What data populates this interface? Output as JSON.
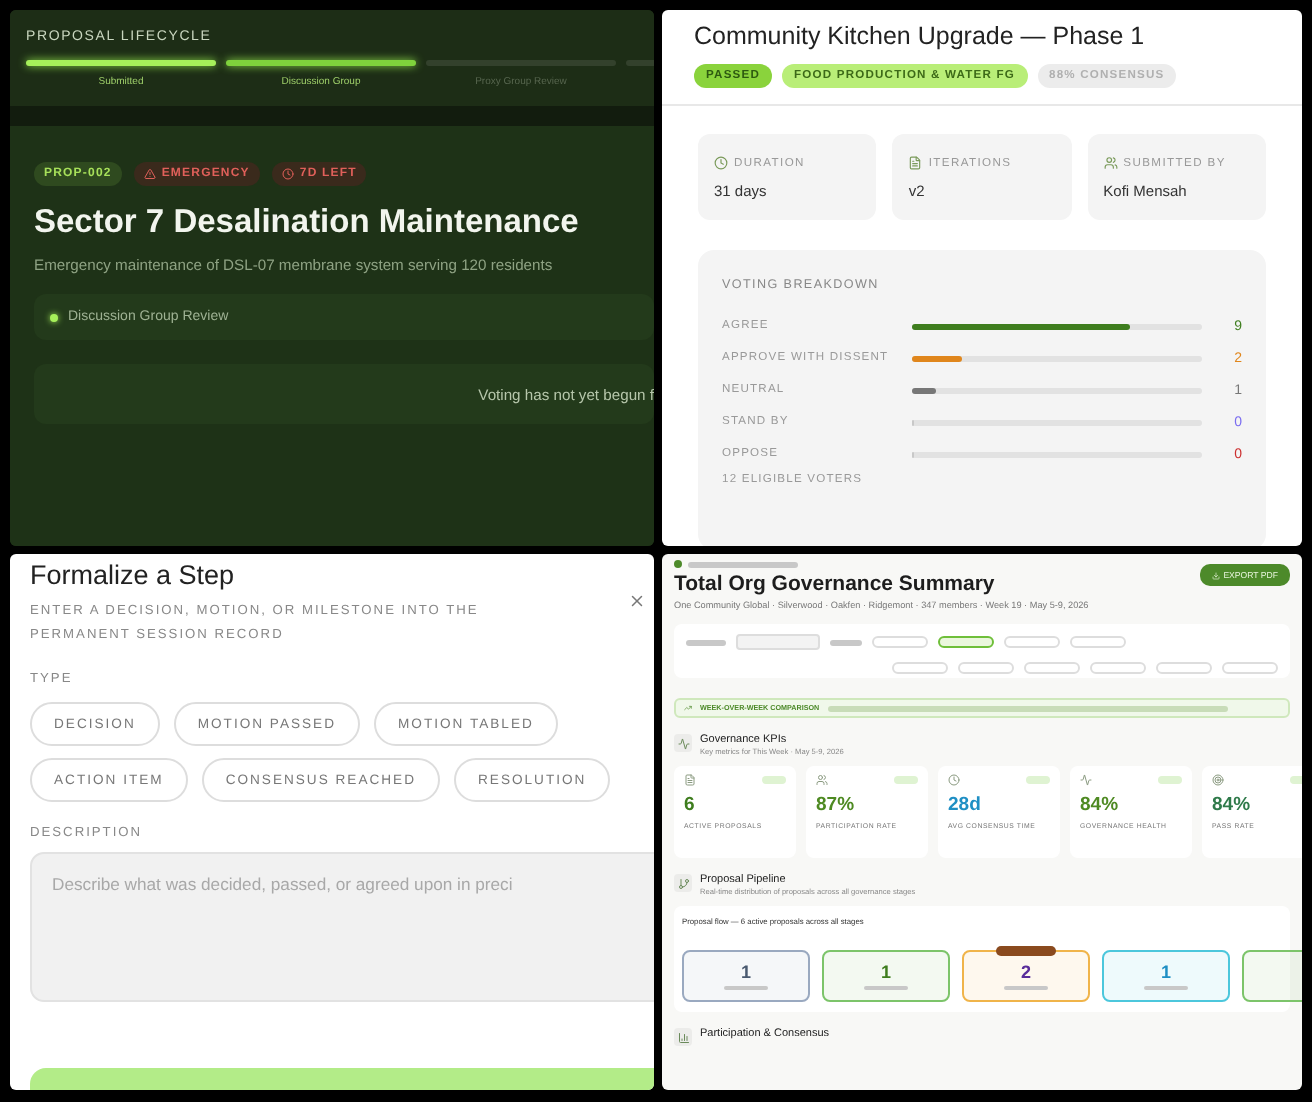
{
  "lifecycle": {
    "heading": "PROPOSAL LIFECYCLE",
    "stages": [
      {
        "label": "Submitted",
        "kind": "done"
      },
      {
        "label": "Discussion Group",
        "kind": "current"
      },
      {
        "label": "Proxy Group Review",
        "kind": "pending"
      },
      {
        "kind": "pending"
      }
    ],
    "tags": [
      {
        "label": "PROP-002",
        "kind": "id"
      },
      {
        "label": "EMERGENCY",
        "kind": "emergency"
      },
      {
        "label": "7D LEFT",
        "kind": "deadline"
      }
    ],
    "title": "Sector 7 Desalination Maintenance",
    "description": "Emergency maintenance of DSL-07 membrane system serving 120 residents",
    "status": "Discussion Group Review",
    "voting_note": "Voting has not yet begun f"
  },
  "proposal": {
    "title": "Community Kitchen Upgrade — Phase 1",
    "badges": [
      {
        "label": "PASSED",
        "kind": "strong"
      },
      {
        "label": "FOOD PRODUCTION & WATER FG",
        "kind": "soft"
      },
      {
        "label": "88% CONSENSUS",
        "kind": "muted"
      }
    ],
    "stats": [
      {
        "label": "DURATION",
        "value": "31 days",
        "kind": "clock"
      },
      {
        "label": "ITERATIONS",
        "value": "v2",
        "kind": "file"
      },
      {
        "label": "SUBMITTED BY",
        "value": "Kofi Mensah",
        "kind": "people"
      }
    ],
    "voting": {
      "title": "VOTING BREAKDOWN",
      "rows": [
        {
          "label": "AGREE",
          "count": "9",
          "level": 0.75,
          "color": "#3e7d1e"
        },
        {
          "label": "APPROVE WITH DISSENT",
          "count": "2",
          "level": 0.17,
          "color": "#e0861c"
        },
        {
          "label": "NEUTRAL",
          "count": "1",
          "level": 0.08,
          "color": "#777777"
        },
        {
          "label": "STAND BY",
          "count": "0",
          "level": 0,
          "color": "#7a6cf0"
        },
        {
          "label": "OPPOSE",
          "count": "0",
          "level": 0,
          "color": "#cc2f2f"
        }
      ],
      "footer": "12 ELIGIBLE VOTERS"
    }
  },
  "formalize": {
    "title": "Formalize a Step",
    "subtitle": "ENTER A DECISION, MOTION, OR MILESTONE INTO THE PERMANENT SESSION RECORD",
    "type_label": "TYPE",
    "types": [
      {
        "label": "DECISION",
        "selected": false
      },
      {
        "label": "MOTION PASSED",
        "selected": false
      },
      {
        "label": "MOTION TABLED",
        "selected": false
      },
      {
        "label": "ACTION ITEM",
        "selected": false
      },
      {
        "label": "CONSENSUS REACHED",
        "selected": false
      },
      {
        "label": "RESOLUTION",
        "selected": false
      }
    ],
    "description_label": "DESCRIPTION",
    "description": {
      "placeholder": "Describe what was decided, passed, or agreed upon in preci"
    }
  },
  "report": {
    "title": "Total Org Governance Summary",
    "subtitle": "One Community Global · Silverwood · Oakfen · Ridgemont · 347 members · Week 19 · May 5-9, 2026",
    "export_button": "EXPORT PDF",
    "comparison": "WEEK-OVER-WEEK COMPARISON",
    "kpis": {
      "title": "Governance KPIs",
      "subtitle": "Key metrics for This Week · May 5-9, 2026",
      "cards": [
        {
          "value": "6",
          "label": "ACTIVE PROPOSALS",
          "color": "#3e7d1e"
        },
        {
          "value": "87%",
          "label": "PARTICIPATION RATE",
          "color": "#4e8a22"
        },
        {
          "value": "28d",
          "label": "AVG CONSENSUS TIME",
          "color": "#1f8fc4"
        },
        {
          "value": "84%",
          "label": "GOVERNANCE HEALTH",
          "color": "#4e8a22"
        },
        {
          "value": "84%",
          "label": "PASS RATE",
          "color": "#2f7a4a"
        }
      ]
    },
    "pipeline": {
      "title": "Proposal Pipeline",
      "subtitle": "Real-time distribution of proposals across all governance stages",
      "flow_title": "Proposal flow — 6 active proposals across all stages",
      "stages": [
        {
          "count": "1",
          "color": "#9aa9c0",
          "flagged": false
        },
        {
          "count": "1",
          "color": "#7cc46a",
          "flagged": false
        },
        {
          "count": "2",
          "color": "#f0b44a",
          "flagged": true
        },
        {
          "count": "1",
          "color": "#4cc7dc",
          "flagged": false
        },
        {
          "color": "#7cc46a",
          "flagged": false
        }
      ]
    },
    "next_section": "Participation & Consensus"
  }
}
